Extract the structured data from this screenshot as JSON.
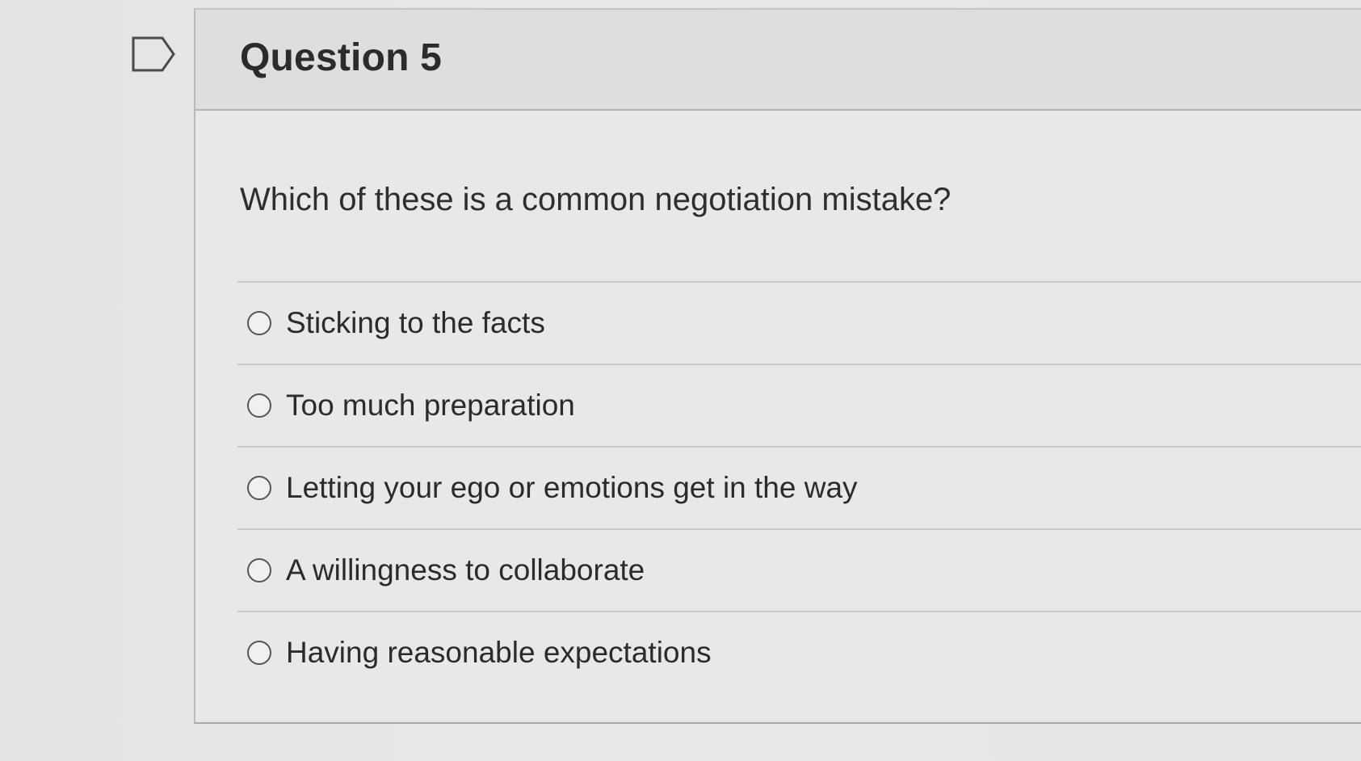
{
  "question": {
    "title": "Question 5",
    "text": "Which of these is a common negotiation mistake?",
    "options": [
      {
        "label": "Sticking to the facts",
        "selected": false
      },
      {
        "label": "Too much preparation",
        "selected": false
      },
      {
        "label": "Letting your ego or emotions get in the way",
        "selected": false
      },
      {
        "label": "A willingness to collaborate",
        "selected": false
      },
      {
        "label": "Having reasonable expectations",
        "selected": false
      }
    ]
  },
  "icons": {
    "flag": "flag-question-icon"
  }
}
